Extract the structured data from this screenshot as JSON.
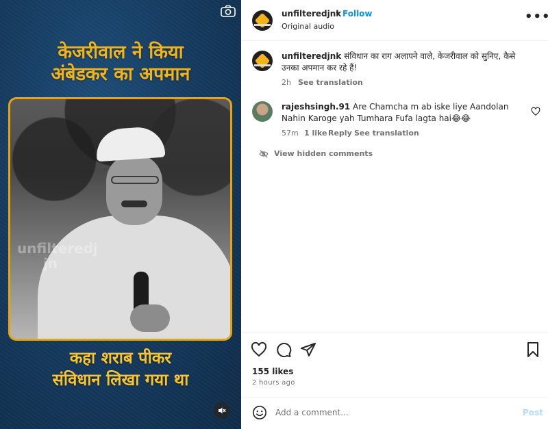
{
  "media": {
    "headline_line1": "केजरीवाल ने किया",
    "headline_line2": "अंबेडकर का अपमान",
    "bottom_line1": "कहा शराब पीकर",
    "bottom_line2": "संविधान लिखा गया था",
    "watermark_line1": "unfilteredj",
    "watermark_line2": "jn",
    "camera_icon": "camera-icon",
    "mute_icon": "speaker-muted-icon",
    "accent_color": "#f3b417"
  },
  "header": {
    "username": "unfilteredjnk",
    "dot": "•",
    "follow_label": "Follow",
    "audio_label": "Original audio",
    "more_label": "•••"
  },
  "caption": {
    "username": "unfilteredjnk",
    "text": "संविधान का राग अलापने वाले, केजरीवाल को सुनिए, कैसे उनका अपमान कर रहे हैं!",
    "time": "2h",
    "translate_label": "See translation"
  },
  "comments": [
    {
      "username": "rajeshsingh.91",
      "text": "Are Chamcha m ab iske liye Aandolan Nahin Karoge yah Tumhara Fufa lagta hai😂😂",
      "time": "57m",
      "likes": "1 like",
      "reply_label": "Reply",
      "translate_label": "See translation"
    }
  ],
  "hidden_comments_label": "View hidden comments",
  "actions": {
    "likes_count": "155 likes",
    "post_date": "2 hours ago"
  },
  "comment_bar": {
    "placeholder": "Add a comment...",
    "post_label": "Post"
  },
  "colors": {
    "link_blue": "#0095f6",
    "post_disabled": "#b3dbff",
    "muted_text": "#737373"
  }
}
